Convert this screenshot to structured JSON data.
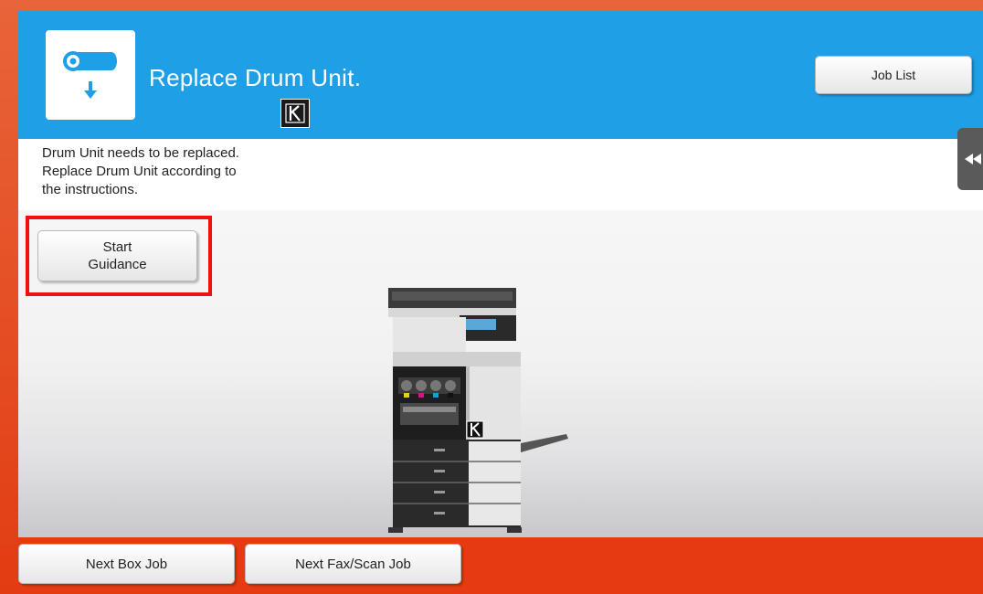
{
  "header": {
    "title": "Replace Drum Unit.",
    "icon": "drum-unit-icon",
    "color_badge": "K",
    "job_list_label": "Job List",
    "bg_color": "#1e9fe6"
  },
  "message": {
    "lines": [
      "Drum Unit needs to be replaced.",
      "Replace Drum Unit according to",
      "the instructions."
    ]
  },
  "guidance": {
    "line1": "Start",
    "line2": "Guidance",
    "highlight_color": "#ee1111"
  },
  "illustration": {
    "icon": "printer-icon",
    "marker_label": "K"
  },
  "footer": {
    "next_box_job_label": "Next Box Job",
    "next_fax_scan_job_label": "Next Fax/Scan Job",
    "bg_color": "#e63a10"
  }
}
